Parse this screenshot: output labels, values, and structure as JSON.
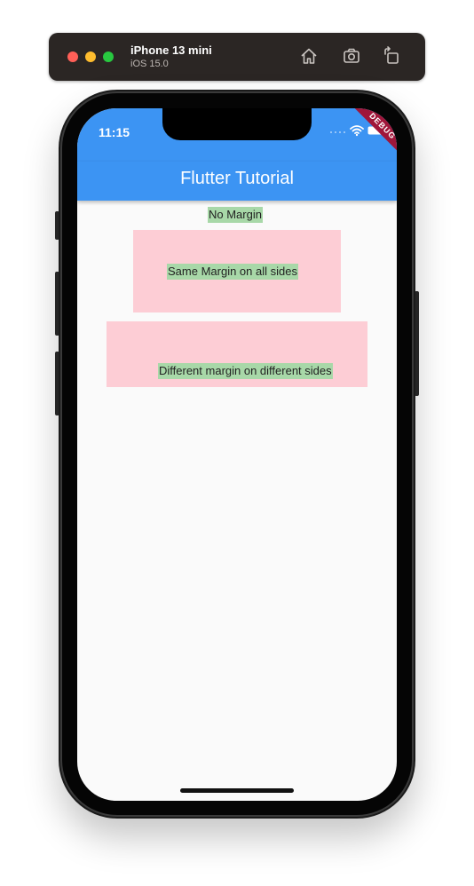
{
  "simulator": {
    "device_name": "iPhone 13 mini",
    "os_version": "iOS 15.0",
    "icons": [
      "home-icon",
      "screenshot-icon",
      "rotate-icon"
    ]
  },
  "status_bar": {
    "time": "11:15",
    "icons": [
      "cellular-icon",
      "wifi-icon",
      "battery-icon"
    ]
  },
  "debug_banner": "DEBUG",
  "app_bar": {
    "title": "Flutter Tutorial",
    "color": "#3c94f3"
  },
  "content": {
    "items": [
      {
        "label": "No Margin"
      },
      {
        "label": "Same Margin on all sides"
      },
      {
        "label": "Different margin on different sides"
      }
    ],
    "colors": {
      "container": "#fdcdd5",
      "text_background": "#a8d8a8"
    }
  }
}
